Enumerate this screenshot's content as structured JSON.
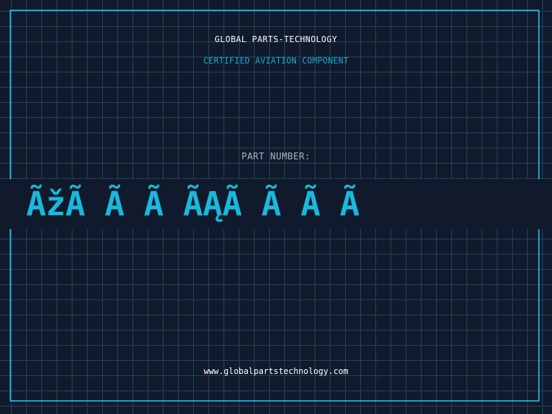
{
  "header": {
    "company_name": "GLOBAL PARTS-TECHNOLOGY",
    "subtitle": "CERTIFIED AVIATION COMPONENT"
  },
  "part": {
    "label": "PART NUMBER:",
    "value": "ÃžÃ Ã Ã ÃĄÃ Ã Ã Ã"
  },
  "footer": {
    "website": "www.globalpartstechnology.com"
  },
  "colors": {
    "background": "#111a2c",
    "grid": "#1e4a5c",
    "accent": "#1aa9d2",
    "text": "#ffffff",
    "label": "#aab3c2"
  }
}
